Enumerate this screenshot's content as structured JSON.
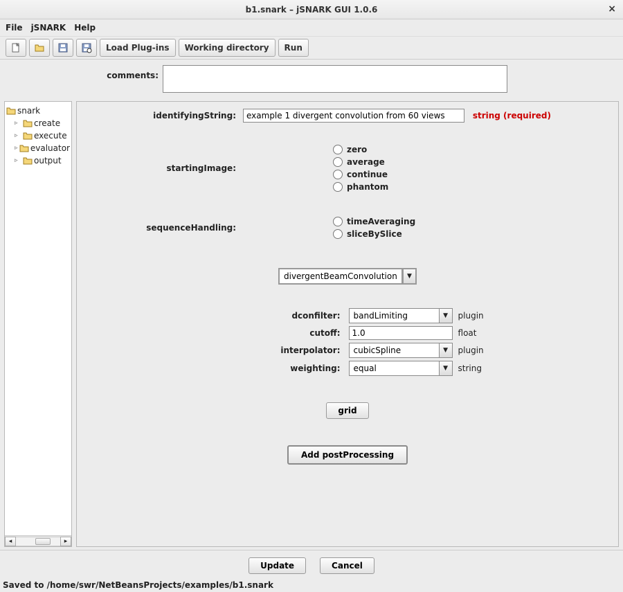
{
  "window": {
    "title": "b1.snark – jSNARK GUI 1.0.6"
  },
  "menu": {
    "file": "File",
    "jsnark": "jSNARK",
    "help": "Help"
  },
  "toolbar": {
    "loadPlugins": "Load Plug-ins",
    "workingDir": "Working directory",
    "run": "Run"
  },
  "comments": {
    "label": "comments:",
    "value": ""
  },
  "tree": {
    "root": "snark",
    "items": [
      "create",
      "execute",
      "evaluator",
      "output"
    ]
  },
  "form": {
    "identifyingString": {
      "label": "identifyingString:",
      "value": "example 1 divergent convolution from 60 views",
      "status": "string (required)"
    },
    "startingImage": {
      "label": "startingImage:",
      "options": [
        "zero",
        "average",
        "continue",
        "phantom"
      ],
      "selected": ""
    },
    "sequenceHandling": {
      "label": "sequenceHandling:",
      "options": [
        "timeAveraging",
        "sliceBySlice"
      ],
      "selected": ""
    },
    "algorithm": {
      "value": "divergentBeamConvolution"
    },
    "params": {
      "dconfilter": {
        "label": "dconfilter:",
        "value": "bandLimiting",
        "type": "plugin"
      },
      "cutoff": {
        "label": "cutoff:",
        "value": "1.0",
        "type": "float"
      },
      "interpolator": {
        "label": "interpolator:",
        "value": "cubicSpline",
        "type": "plugin"
      },
      "weighting": {
        "label": "weighting:",
        "value": "equal",
        "type": "string"
      }
    },
    "gridBtn": "grid",
    "addPostProcessing": "Add postProcessing"
  },
  "footer": {
    "update": "Update",
    "cancel": "Cancel"
  },
  "status": "Saved to /home/swr/NetBeansProjects/examples/b1.snark"
}
